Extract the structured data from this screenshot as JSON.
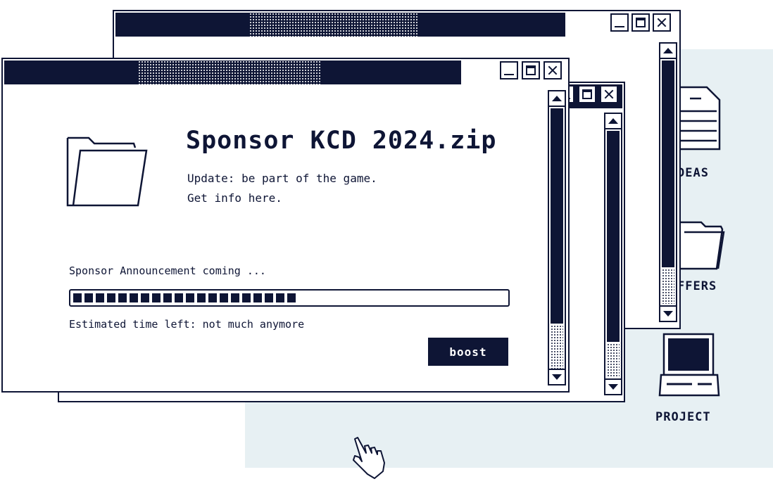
{
  "dialog": {
    "title": "Sponsor KCD 2024.zip",
    "line1": "Update: be part of the game.",
    "line2": "Get info here.",
    "status": "Sponsor Announcement coming ...",
    "progress": 0.52,
    "eta": "Estimated time left: not much anymore",
    "button_label": "boost"
  },
  "desktop": {
    "icons": [
      {
        "label": "IDEAS",
        "visible_text": "DEAS",
        "icon": "document-icon"
      },
      {
        "label": "OFFERS",
        "visible_text": "FFERS",
        "icon": "folder-icon"
      },
      {
        "label": "PROJECT",
        "visible_text": "PROJECT",
        "icon": "computer-icon"
      }
    ]
  },
  "colors": {
    "ink": "#0e1535",
    "desktop": "#e7f0f3",
    "window": "#ffffff"
  }
}
